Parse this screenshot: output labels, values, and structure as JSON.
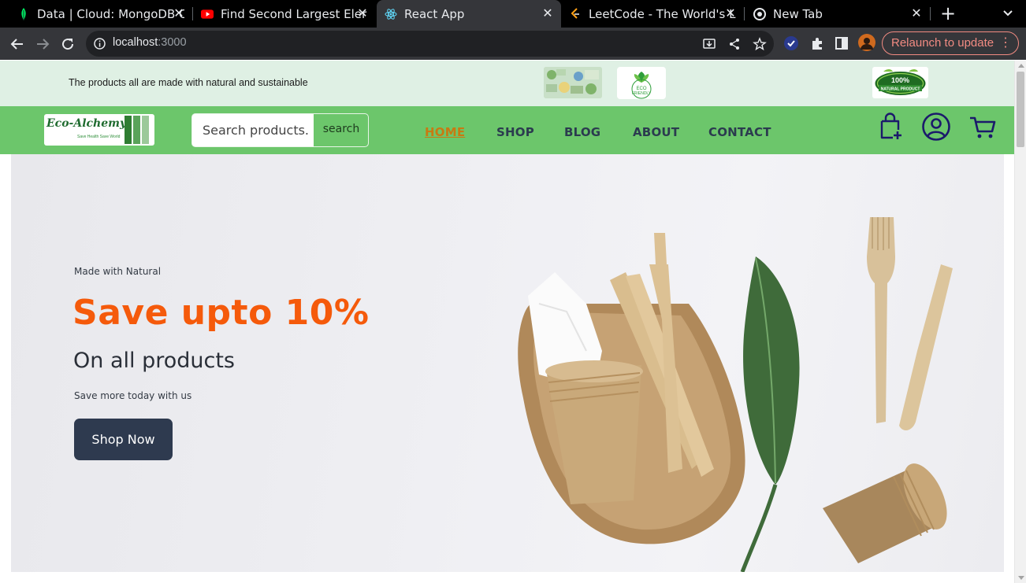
{
  "browser": {
    "tabs": [
      {
        "title": "Data | Cloud: MongoDB C",
        "icon": "mongodb-leaf-icon",
        "active": false
      },
      {
        "title": "Find Second Largest Eler",
        "icon": "youtube-icon",
        "active": false
      },
      {
        "title": "React App",
        "icon": "react-icon",
        "active": true
      },
      {
        "title": "LeetCode - The World's L",
        "icon": "leetcode-icon",
        "active": false
      },
      {
        "title": "New Tab",
        "icon": "chrome-icon",
        "active": false
      }
    ],
    "url_host": "localhost",
    "url_port": ":3000",
    "relaunch_label": "Relaunch to update",
    "close_glyph": "✕",
    "new_tab_glyph": "+",
    "menu_glyph": "⋮"
  },
  "site": {
    "topstrip_text": "The products all are made with natural and sustainable",
    "badges": [
      "eco-collage-badge",
      "eco-friendly-badge",
      "natural-product-badge"
    ],
    "badge_texts": {
      "eco_friendly": "ECO FRIENDLY",
      "natural_top": "100%",
      "natural_bottom": "NATURAL PRODUCT"
    },
    "logo_text": "Eco-Alchemy",
    "logo_tagline": "Save Health Save World",
    "search": {
      "placeholder": "Search products.",
      "button_label": "search"
    },
    "menu": [
      {
        "label": "HOME",
        "active": true
      },
      {
        "label": "SHOP",
        "active": false
      },
      {
        "label": "BLOG",
        "active": false
      },
      {
        "label": "ABOUT",
        "active": false
      },
      {
        "label": "CONTACT",
        "active": false
      }
    ],
    "icons": [
      "add-to-bag-icon",
      "user-account-icon",
      "cart-icon"
    ],
    "colors": {
      "accent": "#f55a0b",
      "nav_green": "#6cc66b",
      "strip": "#dff0e4",
      "active_link": "#c87a12",
      "button": "#2e3a4f"
    }
  },
  "hero": {
    "kicker": "Made with Natural",
    "title": "Save upto 10%",
    "subtitle": "On all products",
    "small": "Save more today with us",
    "cta": "Shop Now"
  }
}
